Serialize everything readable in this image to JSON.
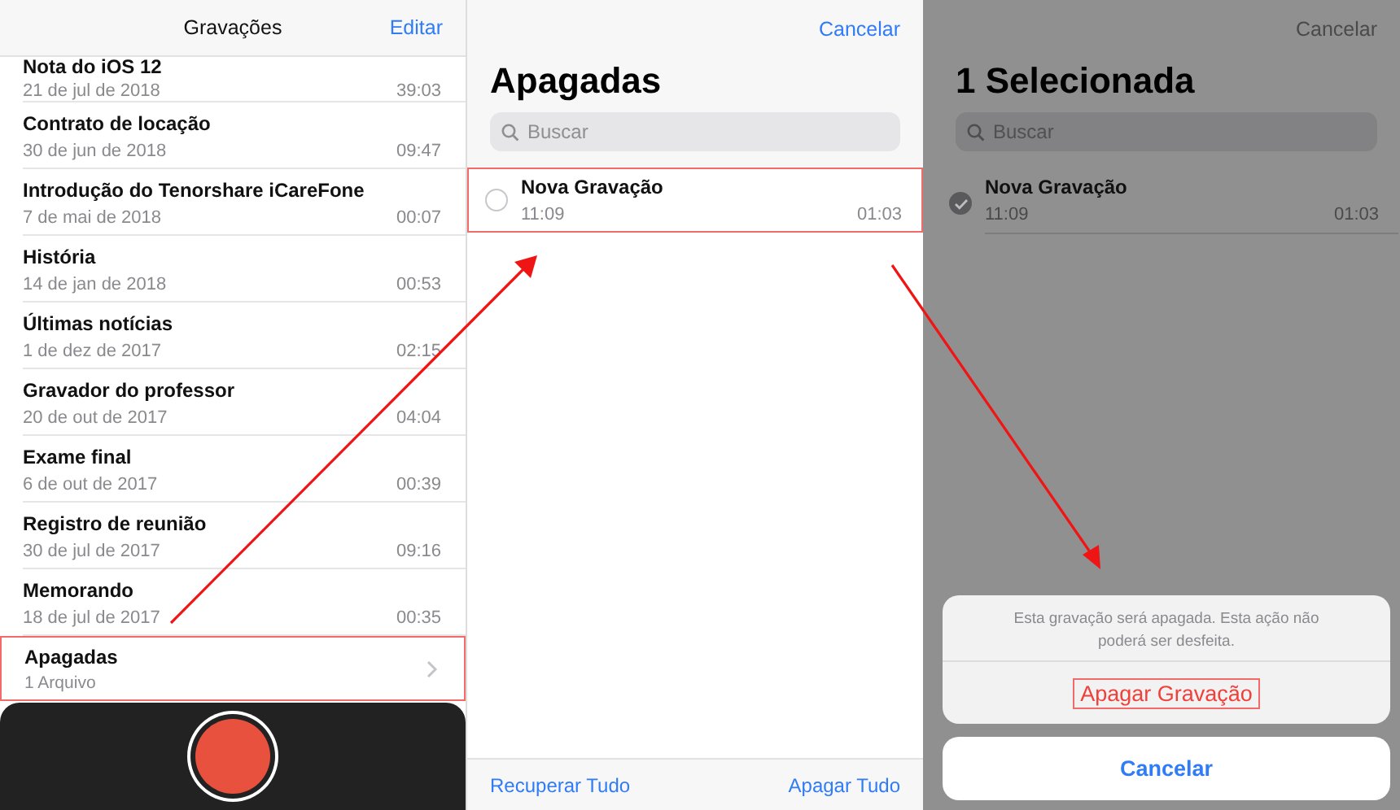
{
  "recordings_screen": {
    "title": "Gravações",
    "edit_button": "Editar",
    "recordings": [
      {
        "title": "Nota do iOS 12",
        "date": "21 de jul de 2018",
        "duration": "39:03"
      },
      {
        "title": "Contrato de locação",
        "date": "30 de jun de 2018",
        "duration": "09:47"
      },
      {
        "title": "Introdução do Tenorshare iCareFone",
        "date": "7 de mai de 2018",
        "duration": "00:07"
      },
      {
        "title": "História",
        "date": "14 de jan de 2018",
        "duration": "00:53"
      },
      {
        "title": "Últimas notícias",
        "date": "1 de dez de 2017",
        "duration": "02:15"
      },
      {
        "title": "Gravador do professor",
        "date": "20 de out de 2017",
        "duration": "04:04"
      },
      {
        "title": "Exame final",
        "date": "6 de out de 2017",
        "duration": "00:39"
      },
      {
        "title": "Registro de reunião",
        "date": "30 de jul de 2017",
        "duration": "09:16"
      },
      {
        "title": "Memorando",
        "date": "18 de jul de 2017",
        "duration": "00:35"
      }
    ],
    "deleted_folder": {
      "title": "Apagadas",
      "count": "1 Arquivo",
      "highlighted": true
    }
  },
  "deleted_screen": {
    "cancel_button": "Cancelar",
    "title": "Apagadas",
    "search": {
      "placeholder": "Buscar"
    },
    "items": [
      {
        "title": "Nova Gravação",
        "time": "11:09",
        "duration": "01:03",
        "selected": false,
        "highlighted": true
      }
    ],
    "toolbar": {
      "recover_button": "Recuperar Tudo",
      "delete_all_button": "Apagar Tudo"
    }
  },
  "selection_screen": {
    "cancel_button": "Cancelar",
    "title": "1 Selecionada",
    "search": {
      "placeholder": "Buscar"
    },
    "items": [
      {
        "title": "Nova Gravação",
        "time": "11:09",
        "duration": "01:03",
        "selected": true,
        "highlighted": false
      }
    ],
    "action_sheet": {
      "message": "Esta gravação será apagada. Esta ação não poderá ser desfeita.",
      "delete_button": {
        "label": "Apagar Gravação",
        "highlighted": true
      },
      "cancel_button": "Cancelar"
    }
  }
}
